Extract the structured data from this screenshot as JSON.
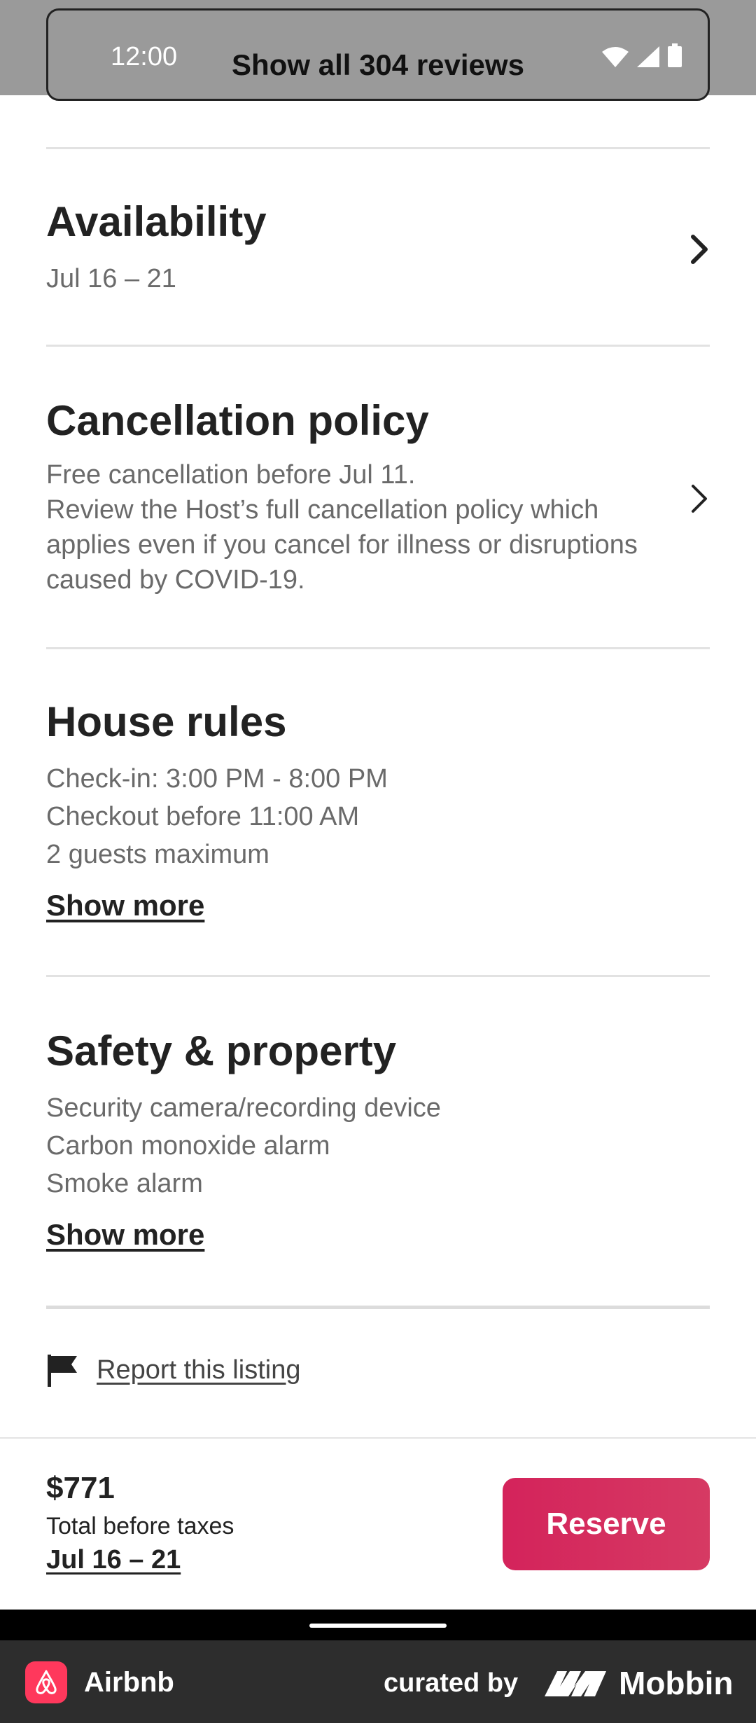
{
  "status_bar": {
    "time": "12:00"
  },
  "reviews": {
    "label": "Show all 304 reviews"
  },
  "availability": {
    "title": "Availability",
    "dates": "Jul 16 – 21"
  },
  "cancellation": {
    "title": "Cancellation policy",
    "lines": [
      "Free cancellation before Jul 11.",
      "Review the Host’s full cancellation policy which",
      "applies even if you cancel for illness or disruptions",
      "caused by COVID-19."
    ]
  },
  "house_rules": {
    "title": "House rules",
    "items": [
      "Check-in: 3:00 PM - 8:00 PM",
      "Checkout before 11:00 AM",
      "2 guests maximum"
    ],
    "show_more": "Show more"
  },
  "safety": {
    "title": "Safety & property",
    "items": [
      "Security camera/recording device",
      "Carbon monoxide alarm",
      "Smoke alarm"
    ],
    "show_more": "Show more"
  },
  "report": {
    "label": "Report this listing"
  },
  "footer": {
    "price": "$771",
    "price_note": "Total before taxes",
    "dates": "Jul 16 – 21",
    "reserve_label": "Reserve"
  },
  "brand_bar": {
    "app_name": "Airbnb",
    "curated_by": "curated by",
    "mobbin": "Mobbin"
  },
  "colors": {
    "accent": "#d4235b",
    "airbnb": "#ff385c"
  }
}
